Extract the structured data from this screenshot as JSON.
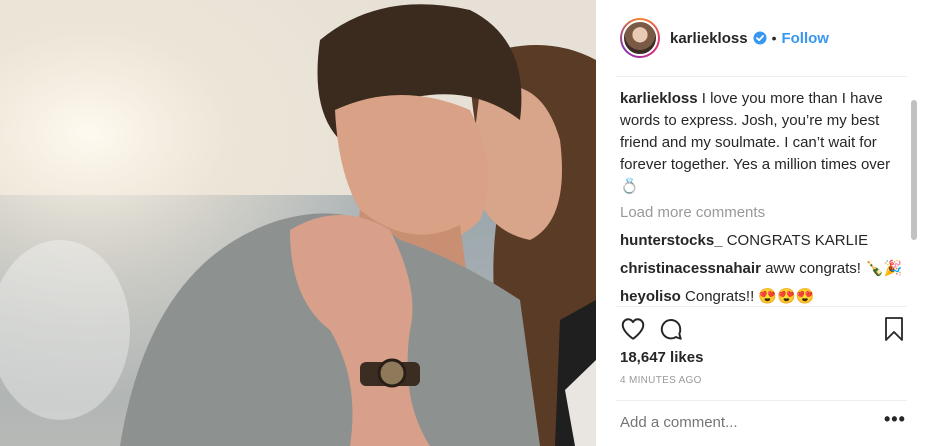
{
  "post": {
    "username": "karliekloss",
    "verified": true,
    "separator": "•",
    "follow_label": "Follow",
    "caption_user": "karliekloss",
    "caption_text": "I love you more than I have words to express. Josh, you’re my best friend and my soulmate. I can’t wait for forever together. Yes a million times over 💍",
    "load_more": "Load more comments",
    "comments": [
      {
        "user": "hunterstocks_",
        "text": "CONGRATS KARLIE"
      },
      {
        "user": "christinacessnahair",
        "text": "aww congrats! 🍾🎉"
      },
      {
        "user": "heyoliso",
        "text": "Congrats!! 😍😍😍"
      }
    ],
    "likes": "18,647 likes",
    "time": "4 MINUTES AGO",
    "add_comment_placeholder": "Add a comment...",
    "more_options": "•••"
  },
  "colors": {
    "accent": "#3897f0",
    "muted": "#999999",
    "text": "#262626"
  },
  "icons": [
    "verified-badge-icon",
    "heart-icon",
    "comment-icon",
    "bookmark-icon",
    "more-options-icon"
  ]
}
